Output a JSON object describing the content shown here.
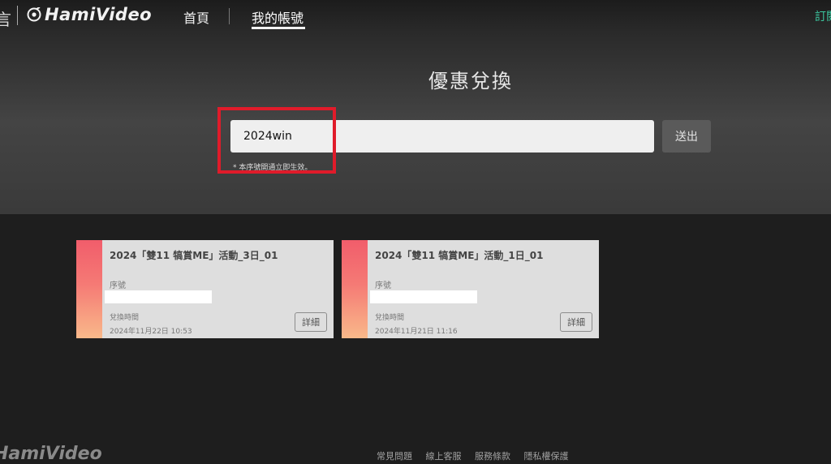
{
  "nav": {
    "left_glyph": "言",
    "logo_text": "HamiVideo",
    "home": "首頁",
    "account": "我的帳號",
    "subscribe": "訂閱"
  },
  "redeem": {
    "title": "優惠兌換",
    "code_value": "2024win",
    "submit_label": "送出",
    "hint": "* 本序號開通立即生效。"
  },
  "cards": [
    {
      "title": "2024「雙11 犒賞ME」活動_3日_01",
      "serial_label": "序號",
      "time_label": "兌換時間",
      "time_value": "2024年11月22日 10:53",
      "detail_label": "詳細"
    },
    {
      "title": "2024「雙11 犒賞ME」活動_1日_01",
      "serial_label": "序號",
      "time_label": "兌換時間",
      "time_value": "2024年11月21日 11:16",
      "detail_label": "詳細"
    }
  ],
  "footer": {
    "logo_text": "HamiVideo",
    "links": [
      "常見問題",
      "線上客服",
      "服務條款",
      "隱私權保護"
    ]
  },
  "colors": {
    "accent_green": "#3cc8a0",
    "highlight_red": "#e01b2a",
    "card_stripe_top": "#f15d6b",
    "card_stripe_bottom": "#f9b98a"
  }
}
